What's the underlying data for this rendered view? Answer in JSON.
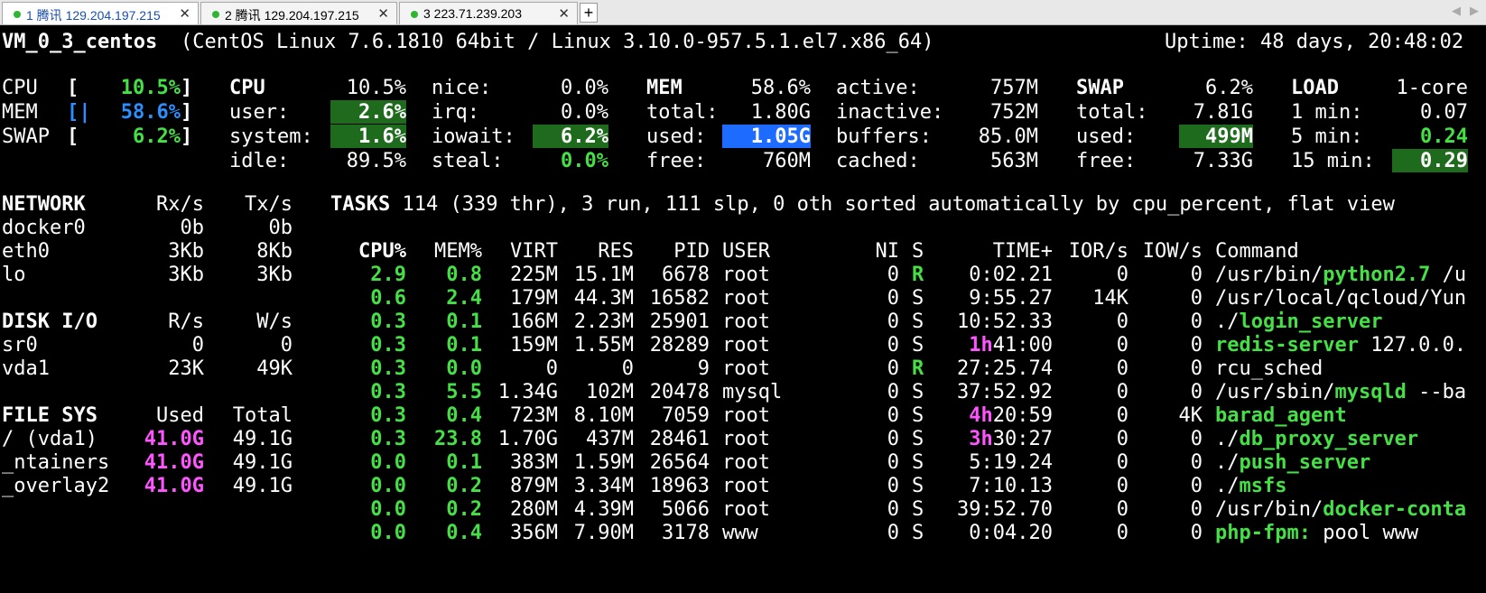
{
  "tabs": [
    {
      "label": "1 腾讯 129.204.197.215",
      "active": true
    },
    {
      "label": "2 腾讯 129.204.197.215",
      "active": false
    },
    {
      "label": "3 223.71.239.203",
      "active": false
    }
  ],
  "tab_new": "+",
  "tab_close": "✕",
  "header": {
    "host": "VM_0_3_centos",
    "sys": "(CentOS Linux 7.6.1810 64bit / Linux 3.10.0-957.5.1.el7.x86_64)",
    "uptime": "Uptime: 48 days, 20:48:02"
  },
  "quicklook": [
    {
      "name": "CPU",
      "bar": "[",
      "pct": "10.5%",
      "end": "]"
    },
    {
      "name": "MEM",
      "bar": "[|",
      "pct": "58.6%",
      "end": "]"
    },
    {
      "name": "SWAP",
      "bar": "[",
      "pct": "6.2%",
      "end": "]"
    }
  ],
  "cpu": {
    "title": "CPU",
    "total": "10.5%",
    "user_l": "user:",
    "user": "2.6%",
    "system_l": "system:",
    "system": "1.6%",
    "idle_l": "idle:",
    "idle": "89.5%",
    "nice_l": "nice:",
    "nice": "0.0%",
    "irq_l": "irq:",
    "irq": "0.0%",
    "iowait_l": "iowait:",
    "iowait": "6.2%",
    "steal_l": "steal:",
    "steal": "0.0%"
  },
  "mem": {
    "title": "MEM",
    "pct": "58.6%",
    "total_l": "total:",
    "total": "1.80G",
    "used_l": "used:",
    "used": "1.05G",
    "free_l": "free:",
    "free": "760M",
    "active_l": "active:",
    "active": "757M",
    "inactive_l": "inactive:",
    "inactive": "752M",
    "buffers_l": "buffers:",
    "buffers": "85.0M",
    "cached_l": "cached:",
    "cached": "563M"
  },
  "swap": {
    "title": "SWAP",
    "pct": "6.2%",
    "total_l": "total:",
    "total": "7.81G",
    "used_l": "used:",
    "used": "499M",
    "free_l": "free:",
    "free": "7.33G"
  },
  "load": {
    "title": "LOAD",
    "cores": "1-core",
    "m1_l": "1 min:",
    "m1": "0.07",
    "m5_l": "5 min:",
    "m5": "0.24",
    "m15_l": "15 min:",
    "m15": "0.29"
  },
  "network": {
    "title": "NETWORK",
    "rx": "Rx/s",
    "tx": "Tx/s",
    "rows": [
      {
        "name": "docker0",
        "rx": "0b",
        "tx": "0b"
      },
      {
        "name": "eth0",
        "rx": "3Kb",
        "tx": "8Kb"
      },
      {
        "name": "lo",
        "rx": "3Kb",
        "tx": "3Kb"
      }
    ]
  },
  "disk": {
    "title": "DISK I/O",
    "r": "R/s",
    "w": "W/s",
    "rows": [
      {
        "name": "sr0",
        "r": "0",
        "w": "0"
      },
      {
        "name": "vda1",
        "r": "23K",
        "w": "49K"
      }
    ]
  },
  "fs": {
    "title": "FILE SYS",
    "used": "Used",
    "total": "Total",
    "rows": [
      {
        "name": "/ (vda1)",
        "used": "41.0G",
        "total": "49.1G"
      },
      {
        "name": "_ntainers",
        "used": "41.0G",
        "total": "49.1G"
      },
      {
        "name": "_overlay2",
        "used": "41.0G",
        "total": "49.1G"
      }
    ]
  },
  "tasks": {
    "label": "TASKS",
    "text": " 114 (339 thr), 3 run, 111 slp, 0 oth sorted automatically by cpu_percent, flat view"
  },
  "proc_headers": {
    "cpu": "CPU%",
    "mem": "MEM%",
    "virt": "VIRT",
    "res": "RES",
    "pid": "PID",
    "user": "USER",
    "ni": "NI",
    "s": "S",
    "time": "TIME+",
    "ior": "IOR/s",
    "iow": "IOW/s",
    "cmd": "Command"
  },
  "processes": [
    {
      "cpu": "2.9",
      "mem": "0.8",
      "virt": "225M",
      "res": "15.1M",
      "pid": "6678",
      "user": "root",
      "ni": "0",
      "s": "R",
      "time_h": "",
      "time": "0:02.21",
      "ior": "0",
      "iow": "0",
      "cmd_pre": "/usr/bin/",
      "cmd_hl": "python2.7",
      "cmd_post": " /u"
    },
    {
      "cpu": "0.6",
      "mem": "2.4",
      "virt": "179M",
      "res": "44.3M",
      "pid": "16582",
      "user": "root",
      "ni": "0",
      "s": "S",
      "time_h": "",
      "time": "9:55.27",
      "ior": "14K",
      "iow": "0",
      "cmd_pre": "/usr/local/qcloud/Yun",
      "cmd_hl": "",
      "cmd_post": ""
    },
    {
      "cpu": "0.3",
      "mem": "0.1",
      "virt": "166M",
      "res": "2.23M",
      "pid": "25901",
      "user": "root",
      "ni": "0",
      "s": "S",
      "time_h": "",
      "time": "10:52.33",
      "ior": "0",
      "iow": "0",
      "cmd_pre": "./",
      "cmd_hl": "login_server",
      "cmd_post": ""
    },
    {
      "cpu": "0.3",
      "mem": "0.1",
      "virt": "159M",
      "res": "1.55M",
      "pid": "28289",
      "user": "root",
      "ni": "0",
      "s": "S",
      "time_h": "1h",
      "time": "41:00",
      "ior": "0",
      "iow": "0",
      "cmd_pre": "",
      "cmd_hl": "redis-server",
      "cmd_post": " 127.0.0."
    },
    {
      "cpu": "0.3",
      "mem": "0.0",
      "virt": "0",
      "res": "0",
      "pid": "9",
      "user": "root",
      "ni": "0",
      "s": "R",
      "time_h": "",
      "time": "27:25.74",
      "ior": "0",
      "iow": "0",
      "cmd_pre": "rcu_sched",
      "cmd_hl": "",
      "cmd_post": ""
    },
    {
      "cpu": "0.3",
      "mem": "5.5",
      "virt": "1.34G",
      "res": "102M",
      "pid": "20478",
      "user": "mysql",
      "ni": "0",
      "s": "S",
      "time_h": "",
      "time": "37:52.92",
      "ior": "0",
      "iow": "0",
      "cmd_pre": "/usr/sbin/",
      "cmd_hl": "mysqld",
      "cmd_post": " --ba"
    },
    {
      "cpu": "0.3",
      "mem": "0.4",
      "virt": "723M",
      "res": "8.10M",
      "pid": "7059",
      "user": "root",
      "ni": "0",
      "s": "S",
      "time_h": "4h",
      "time": "20:59",
      "ior": "0",
      "iow": "4K",
      "cmd_pre": "",
      "cmd_hl": "barad_agent",
      "cmd_post": ""
    },
    {
      "cpu": "0.3",
      "mem": "23.8",
      "virt": "1.70G",
      "res": "437M",
      "pid": "28461",
      "user": "root",
      "ni": "0",
      "s": "S",
      "time_h": "3h",
      "time": "30:27",
      "ior": "0",
      "iow": "0",
      "cmd_pre": "./",
      "cmd_hl": "db_proxy_server",
      "cmd_post": ""
    },
    {
      "cpu": "0.0",
      "mem": "0.1",
      "virt": "383M",
      "res": "1.59M",
      "pid": "26564",
      "user": "root",
      "ni": "0",
      "s": "S",
      "time_h": "",
      "time": "5:19.24",
      "ior": "0",
      "iow": "0",
      "cmd_pre": "./",
      "cmd_hl": "push_server",
      "cmd_post": ""
    },
    {
      "cpu": "0.0",
      "mem": "0.2",
      "virt": "879M",
      "res": "3.34M",
      "pid": "18963",
      "user": "root",
      "ni": "0",
      "s": "S",
      "time_h": "",
      "time": "7:10.13",
      "ior": "0",
      "iow": "0",
      "cmd_pre": "./",
      "cmd_hl": "msfs",
      "cmd_post": ""
    },
    {
      "cpu": "0.0",
      "mem": "0.2",
      "virt": "280M",
      "res": "4.39M",
      "pid": "5066",
      "user": "root",
      "ni": "0",
      "s": "S",
      "time_h": "",
      "time": "39:52.70",
      "ior": "0",
      "iow": "0",
      "cmd_pre": "/usr/bin/",
      "cmd_hl": "docker-conta",
      "cmd_post": ""
    },
    {
      "cpu": "0.0",
      "mem": "0.4",
      "virt": "356M",
      "res": "7.90M",
      "pid": "3178",
      "user": "www",
      "ni": "0",
      "s": "S",
      "time_h": "",
      "time": "0:04.20",
      "ior": "0",
      "iow": "0",
      "cmd_pre": "",
      "cmd_hl": "php-fpm:",
      "cmd_post": " pool www"
    }
  ],
  "colors": {
    "green": "#45e045",
    "magenta": "#ff55ff",
    "blue": "#2b8fff",
    "highlight_green": "#1e6b1e",
    "highlight_blue": "#1e6bff"
  }
}
